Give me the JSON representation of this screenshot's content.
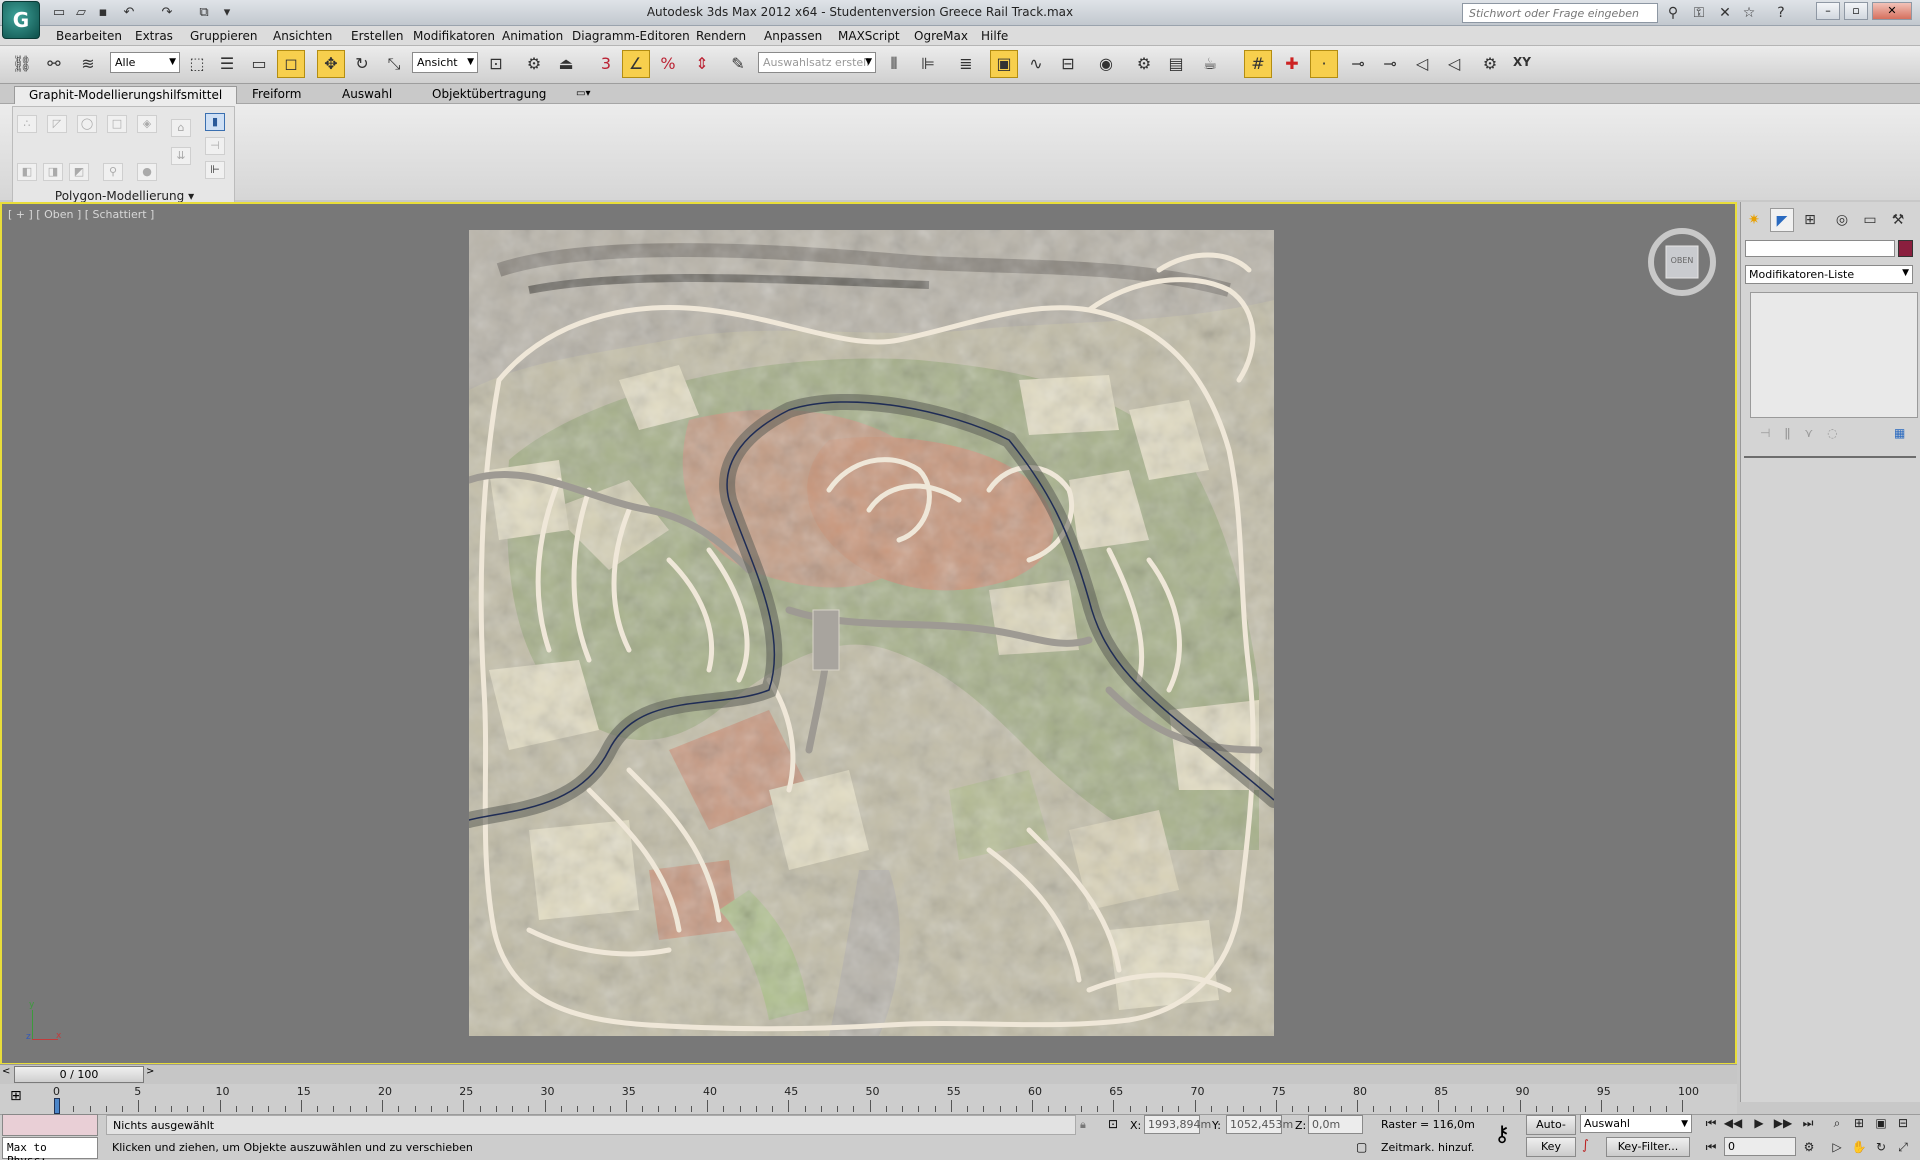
{
  "app": {
    "title": "Autodesk 3ds Max  2012 x64   - Studentenversion    Greece Rail Track.max",
    "logo_letter": "G",
    "search_placeholder": "Stichwort oder Frage eingeben"
  },
  "menu": [
    "Bearbeiten",
    "Extras",
    "Gruppieren",
    "Ansichten",
    "Erstellen",
    "Modifikatoren",
    "Animation",
    "Diagramm-Editoren",
    "Rendern",
    "Anpassen",
    "MAXScript",
    "OgreMax",
    "Hilfe"
  ],
  "toolbar": {
    "selection_filter": "Alle",
    "reference_coord": "Ansicht",
    "named_selection": "Auswahlsatz erstell",
    "xy_label": "XY"
  },
  "ribbon": {
    "tabs": [
      "Graphit-Modellierungshilfsmittel",
      "Freiform",
      "Auswahl",
      "Objektübertragung"
    ],
    "active_tab": 0,
    "panel_label": "Polygon-Modellierung"
  },
  "viewport": {
    "label": "[ + ] [ Oben ] [ Schattiert ]",
    "viewcube_face": "OBEN",
    "axis_x": "x",
    "axis_y": "y",
    "axis_z": "z"
  },
  "command_panel": {
    "modifier_list": "Modifikatoren-Liste",
    "object_color": "#8a1f3e"
  },
  "timeline": {
    "frame_display": "0 / 100",
    "tick_labels": [
      "0",
      "5",
      "10",
      "15",
      "20",
      "25",
      "30",
      "35",
      "40",
      "45",
      "50",
      "55",
      "60",
      "65",
      "70",
      "75",
      "80",
      "85",
      "90",
      "95",
      "100"
    ]
  },
  "status": {
    "maxscript": "Max to Physc:",
    "selection": "Nichts ausgewählt",
    "prompt": "Klicken und ziehen, um Objekte auszuwählen und zu verschieben",
    "x_label": "X:",
    "x_value": "1993,894m",
    "y_label": "Y:",
    "y_value": "1052,453m",
    "z_label": "Z:",
    "z_value": "0,0m",
    "grid": "Raster = 116,0m",
    "add_time_tag": "Zeitmark. hinzuf.",
    "auto_key": "Auto-Key",
    "set_key": "Key eins.",
    "key_mode": "Auswahl",
    "key_filters": "Key-Filter...",
    "current_frame": "0"
  }
}
